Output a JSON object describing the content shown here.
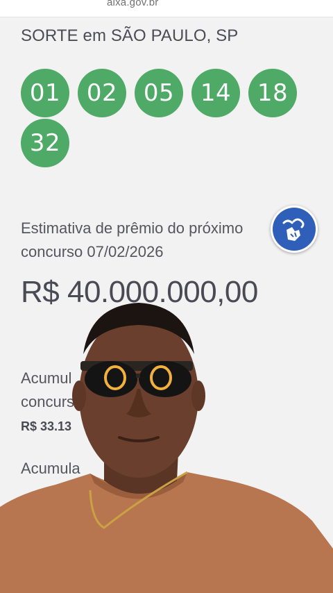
{
  "browser": {
    "url": "aixa.gov.br"
  },
  "result": {
    "location": "SORTE em SÃO PAULO, SP",
    "numbers": [
      "01",
      "02",
      "05",
      "14",
      "18",
      "32"
    ],
    "ball_color": "#4eaa66"
  },
  "estimate": {
    "label": "Estimativa de prêmio do próximo concurso 07/02/2026",
    "value": "R$ 40.000.000,00"
  },
  "accumulated_1": {
    "label_line1": "Acumul",
    "label_line2": "concurs",
    "value": "R$ 33.13"
  },
  "accumulated_2": {
    "label": "Acumula"
  },
  "accessibility": {
    "icon": "sign-language-icon",
    "color": "#2f5fb8"
  },
  "overlay": {
    "subject": "person-overlay",
    "shirt_color": "#b87650"
  }
}
